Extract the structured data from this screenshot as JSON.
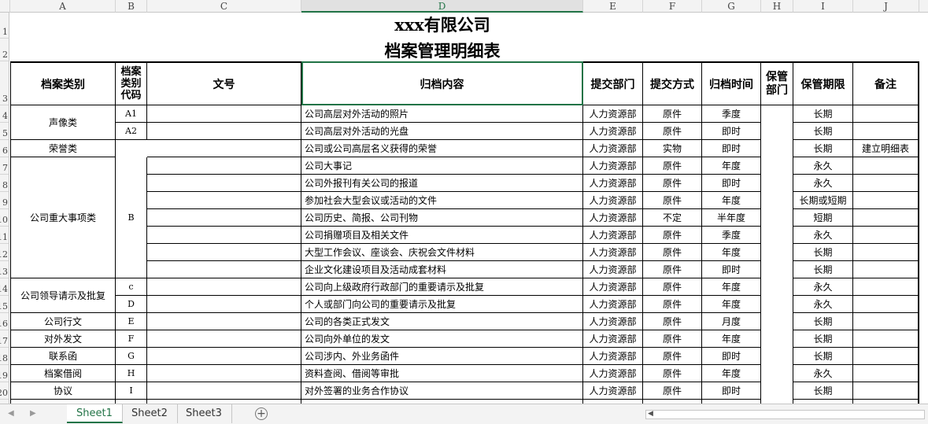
{
  "columns": [
    "A",
    "B",
    "C",
    "D",
    "E",
    "F",
    "G",
    "H",
    "I",
    "J"
  ],
  "row_numbers": [
    "1",
    "2",
    "3",
    "4",
    "5",
    "6",
    "7",
    "8",
    "9",
    "10",
    "11",
    "12",
    "13",
    "14",
    "15",
    "16",
    "17",
    "18",
    "19",
    "20"
  ],
  "title": {
    "line1": "xxx有限公司",
    "line2": "档案管理明细表"
  },
  "headers": {
    "category": "档案类别",
    "code": "档案类别代码",
    "doc_no": "文号",
    "content": "归档内容",
    "dept": "提交部门",
    "method": "提交方式",
    "time": "归档时间",
    "keeper": "保管部门",
    "period": "保管期限",
    "note": "备注"
  },
  "groups": [
    {
      "category": "声像类",
      "code": ""
    },
    {
      "category": "荣誉类",
      "code": ""
    },
    {
      "category": "公司重大事项类",
      "code": "B"
    },
    {
      "category": "公司领导请示及批复",
      "code": ""
    },
    {
      "category": "公司行文",
      "code": "E"
    },
    {
      "category": "对外发文",
      "code": "F"
    },
    {
      "category": "联系函",
      "code": "G"
    },
    {
      "category": "档案借阅",
      "code": "H"
    },
    {
      "category": "协议",
      "code": "I"
    }
  ],
  "rows": [
    {
      "code": "A1",
      "content": "公司高层对外活动的照片",
      "dept": "人力资源部",
      "method": "原件",
      "time": "季度",
      "period": "长期",
      "note": ""
    },
    {
      "code": "A2",
      "content": "公司高层对外活动的光盘",
      "dept": "人力资源部",
      "method": "原件",
      "time": "即时",
      "period": "长期",
      "note": ""
    },
    {
      "code": "",
      "content": "公司或公司高层名义获得的荣誉",
      "dept": "人力资源部",
      "method": "实物",
      "time": "即时",
      "period": "长期",
      "note": "建立明细表"
    },
    {
      "code": "",
      "content": "公司大事记",
      "dept": "人力资源部",
      "method": "原件",
      "time": "年度",
      "period": "永久",
      "note": ""
    },
    {
      "code": "",
      "content": "公司外报刊有关公司的报道",
      "dept": "人力资源部",
      "method": "原件",
      "time": "即时",
      "period": "永久",
      "note": ""
    },
    {
      "code": "",
      "content": "参加社会大型会议或活动的文件",
      "dept": "人力资源部",
      "method": "原件",
      "time": "年度",
      "period": "长期或短期",
      "note": ""
    },
    {
      "code": "",
      "content": "公司历史、简报、公司刊物",
      "dept": "人力资源部",
      "method": "不定",
      "time": "半年度",
      "period": "短期",
      "note": ""
    },
    {
      "code": "",
      "content": "公司捐赠项目及相关文件",
      "dept": "人力资源部",
      "method": "原件",
      "time": "季度",
      "period": "永久",
      "note": ""
    },
    {
      "code": "",
      "content": "大型工作会议、座谈会、庆祝会文件材料",
      "dept": "人力资源部",
      "method": "原件",
      "time": "年度",
      "period": "长期",
      "note": ""
    },
    {
      "code": "",
      "content": "企业文化建设项目及活动成套材料",
      "dept": "人力资源部",
      "method": "原件",
      "time": "即时",
      "period": "长期",
      "note": ""
    },
    {
      "code": "c",
      "content": "公司向上级政府行政部门的重要请示及批复",
      "dept": "人力资源部",
      "method": "原件",
      "time": "年度",
      "period": "永久",
      "note": ""
    },
    {
      "code": "D",
      "content": "个人或部门向公司的重要请示及批复",
      "dept": "人力资源部",
      "method": "原件",
      "time": "年度",
      "period": "永久",
      "note": ""
    },
    {
      "code": "",
      "content": "公司的各类正式发文",
      "dept": "人力资源部",
      "method": "原件",
      "time": "月度",
      "period": "长期",
      "note": ""
    },
    {
      "code": "",
      "content": "公司向外单位的发文",
      "dept": "人力资源部",
      "method": "原件",
      "time": "年度",
      "period": "长期",
      "note": ""
    },
    {
      "code": "",
      "content": "公司涉内、外业务函件",
      "dept": "人力资源部",
      "method": "原件",
      "time": "即时",
      "period": "长期",
      "note": ""
    },
    {
      "code": "",
      "content": "资料查阅、借阅等审批",
      "dept": "人力资源部",
      "method": "原件",
      "time": "年度",
      "period": "永久",
      "note": ""
    },
    {
      "code": "",
      "content": "对外签署的业务合作协议",
      "dept": "人力资源部",
      "method": "原件",
      "time": "即时",
      "period": "长期",
      "note": ""
    }
  ],
  "tabs": [
    "Sheet1",
    "Sheet2",
    "Sheet3"
  ],
  "active_tab": "Sheet1",
  "colors": {
    "accent": "#217346",
    "header_bg": "#f3f3f3"
  }
}
